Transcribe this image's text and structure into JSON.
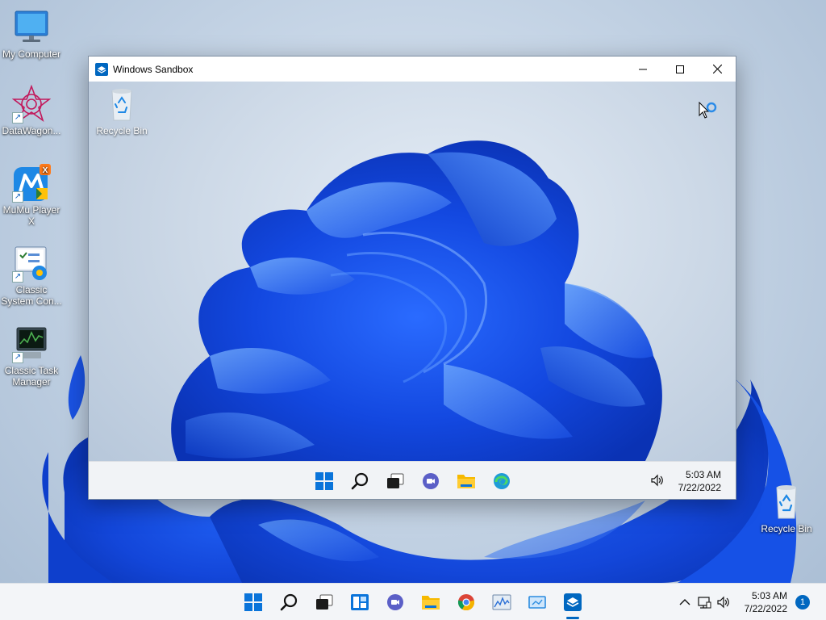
{
  "desktop": {
    "icons": [
      {
        "label": "My Computer",
        "icon": "monitor-icon"
      },
      {
        "label": "DataWagon...",
        "icon": "datawagon-icon"
      },
      {
        "label": "MuMu Player X",
        "icon": "mumu-player-icon"
      },
      {
        "label": "Classic System Con...",
        "icon": "control-panel-icon"
      },
      {
        "label": "Classic Task Manager",
        "icon": "task-manager-icon"
      }
    ],
    "recycle_bin_label": "Recycle Bin"
  },
  "sandbox_window": {
    "title": "Windows Sandbox",
    "guest_desktop": {
      "recycle_bin_label": "Recycle Bin"
    },
    "guest_taskbar": {
      "apps": [
        "start-icon",
        "search-icon",
        "task-view-icon",
        "chat-icon",
        "file-explorer-icon",
        "edge-icon"
      ],
      "time": "5:03 AM",
      "date": "7/22/2022"
    }
  },
  "taskbar": {
    "apps": [
      "start-icon",
      "search-icon",
      "task-view-icon",
      "widgets-icon",
      "chat-icon",
      "file-explorer-icon",
      "chrome-icon",
      "resource-monitor-icon",
      "remote-desktop-icon",
      "windows-sandbox-icon"
    ],
    "active_app": "windows-sandbox-icon",
    "time": "5:03 AM",
    "date": "7/22/2022",
    "notification_count": "1"
  },
  "colors": {
    "accent": "#0067c0",
    "bloom_dark": "#0a3fd6",
    "bloom_light": "#3f8bff"
  }
}
